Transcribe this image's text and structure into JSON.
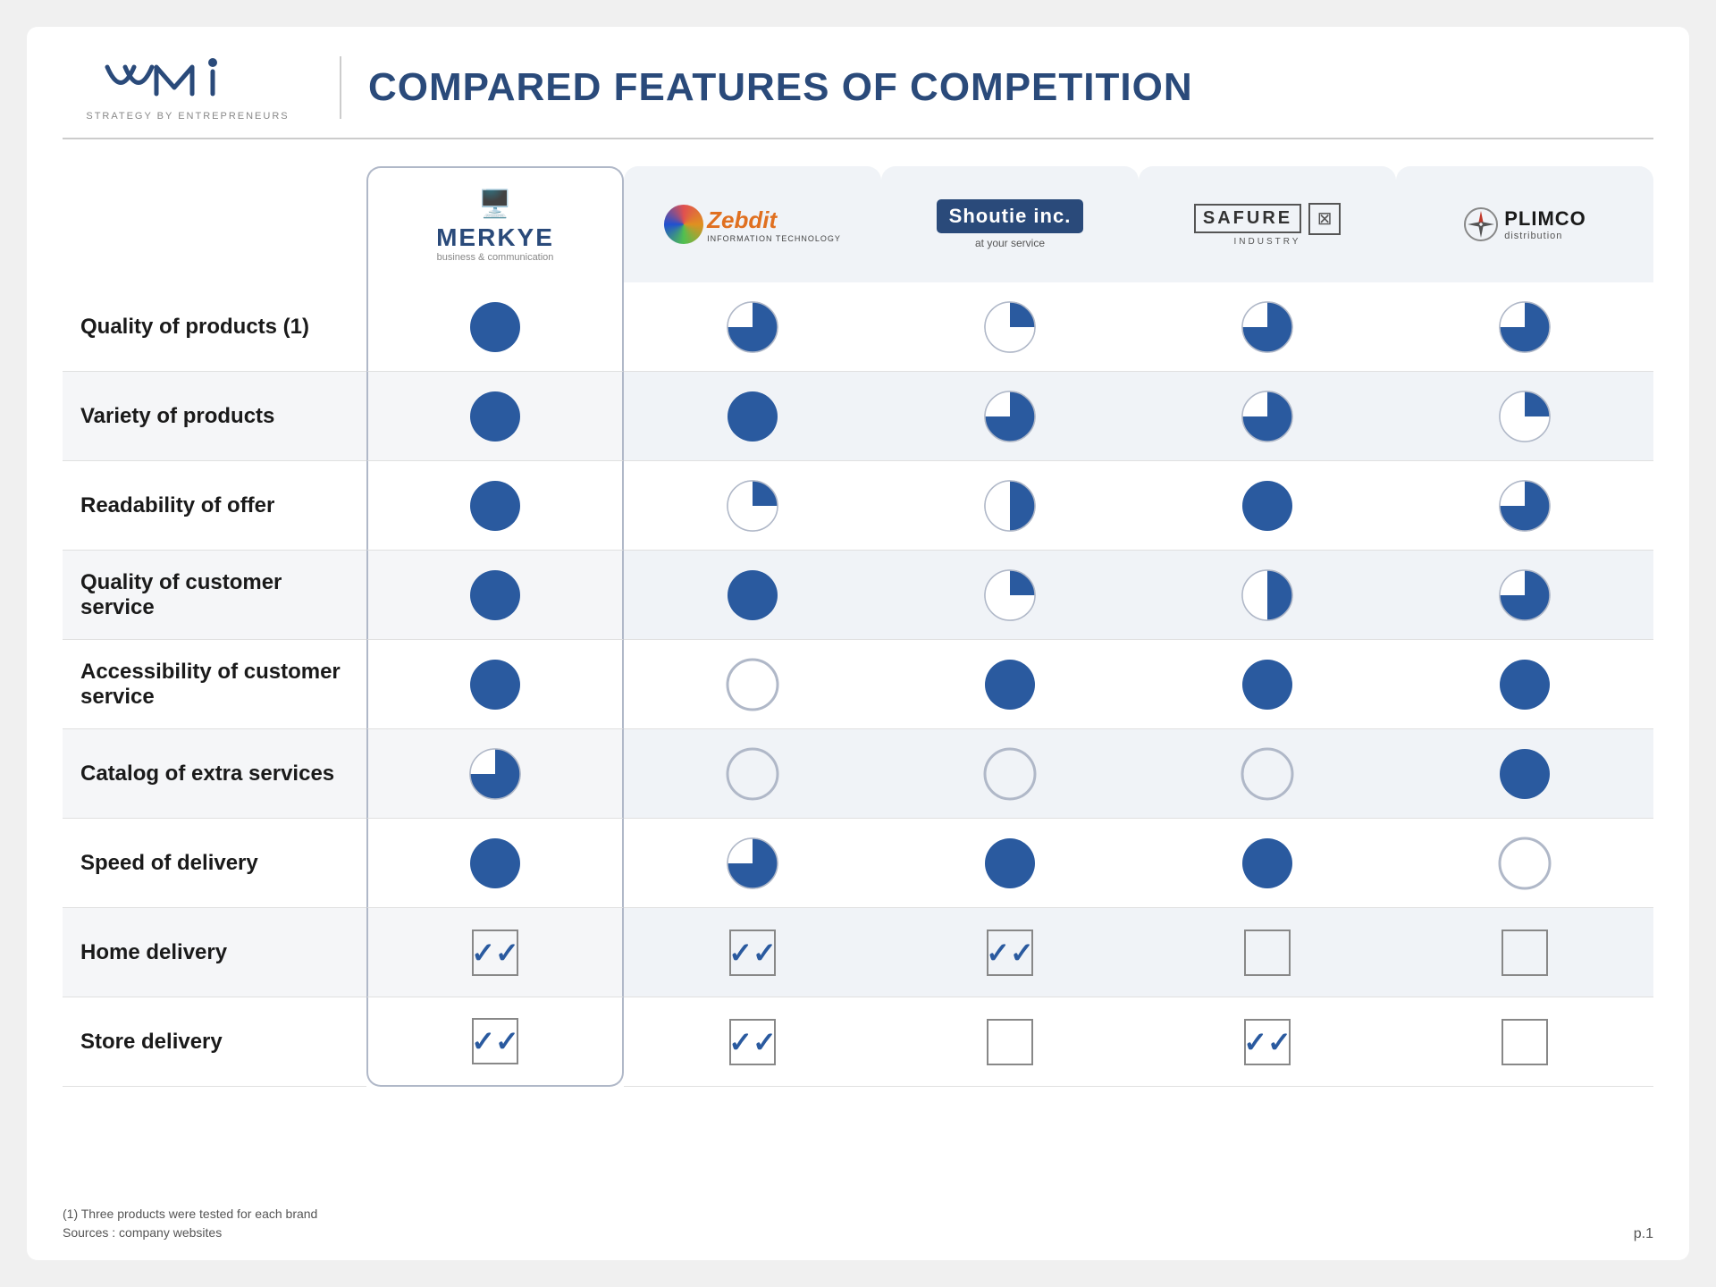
{
  "slide": {
    "title": "COMPARED FEATURES OF COMPETITION",
    "logo": {
      "name": "WMI",
      "subtitle": "STRATEGY BY ENTREPRENEURS"
    }
  },
  "brands": [
    {
      "id": "merkye",
      "name": "MERKYE",
      "subtitle": "business & communication",
      "type": "merkye"
    },
    {
      "id": "zebdit",
      "name": "Zebdit",
      "subtitle": "information technology",
      "type": "zebdit"
    },
    {
      "id": "shoutie",
      "name": "Shoutie inc.",
      "subtitle": "at your service",
      "type": "shoutie"
    },
    {
      "id": "safure",
      "name": "SAFURE",
      "subtitle": "INDUSTRY",
      "type": "safure"
    },
    {
      "id": "plimco",
      "name": "PLIMCO",
      "subtitle": "distribution",
      "type": "plimco"
    }
  ],
  "features": [
    {
      "label": "Quality of products (1)",
      "alt": false,
      "values": [
        "full",
        "three-quarter",
        "quarter",
        "three-quarter",
        "three-quarter"
      ]
    },
    {
      "label": "Variety of products",
      "alt": true,
      "values": [
        "full",
        "full",
        "three-quarter",
        "three-quarter",
        "quarter"
      ]
    },
    {
      "label": "Readability of offer",
      "alt": false,
      "values": [
        "full",
        "quarter",
        "half",
        "full",
        "three-quarter"
      ]
    },
    {
      "label": "Quality of customer service",
      "alt": true,
      "values": [
        "full",
        "full",
        "quarter",
        "half",
        "three-quarter"
      ]
    },
    {
      "label": "Accessibility of customer service",
      "alt": false,
      "values": [
        "full",
        "empty",
        "full",
        "full",
        "full"
      ]
    },
    {
      "label": "Catalog of extra services",
      "alt": true,
      "values": [
        "three-quarter",
        "empty",
        "empty",
        "empty",
        "full"
      ]
    },
    {
      "label": "Speed of delivery",
      "alt": false,
      "values": [
        "full",
        "three-quarter",
        "full",
        "full",
        "empty"
      ]
    },
    {
      "label": "Home delivery",
      "alt": true,
      "values": [
        "check",
        "check",
        "check",
        "empty-box",
        "empty-box"
      ]
    },
    {
      "label": "Store delivery",
      "alt": false,
      "values": [
        "check",
        "check",
        "empty-box",
        "check",
        "empty-box"
      ]
    }
  ],
  "footer": {
    "note1": "(1) Three products were tested for each brand",
    "note2": "Sources : company websites",
    "page": "p.1"
  }
}
